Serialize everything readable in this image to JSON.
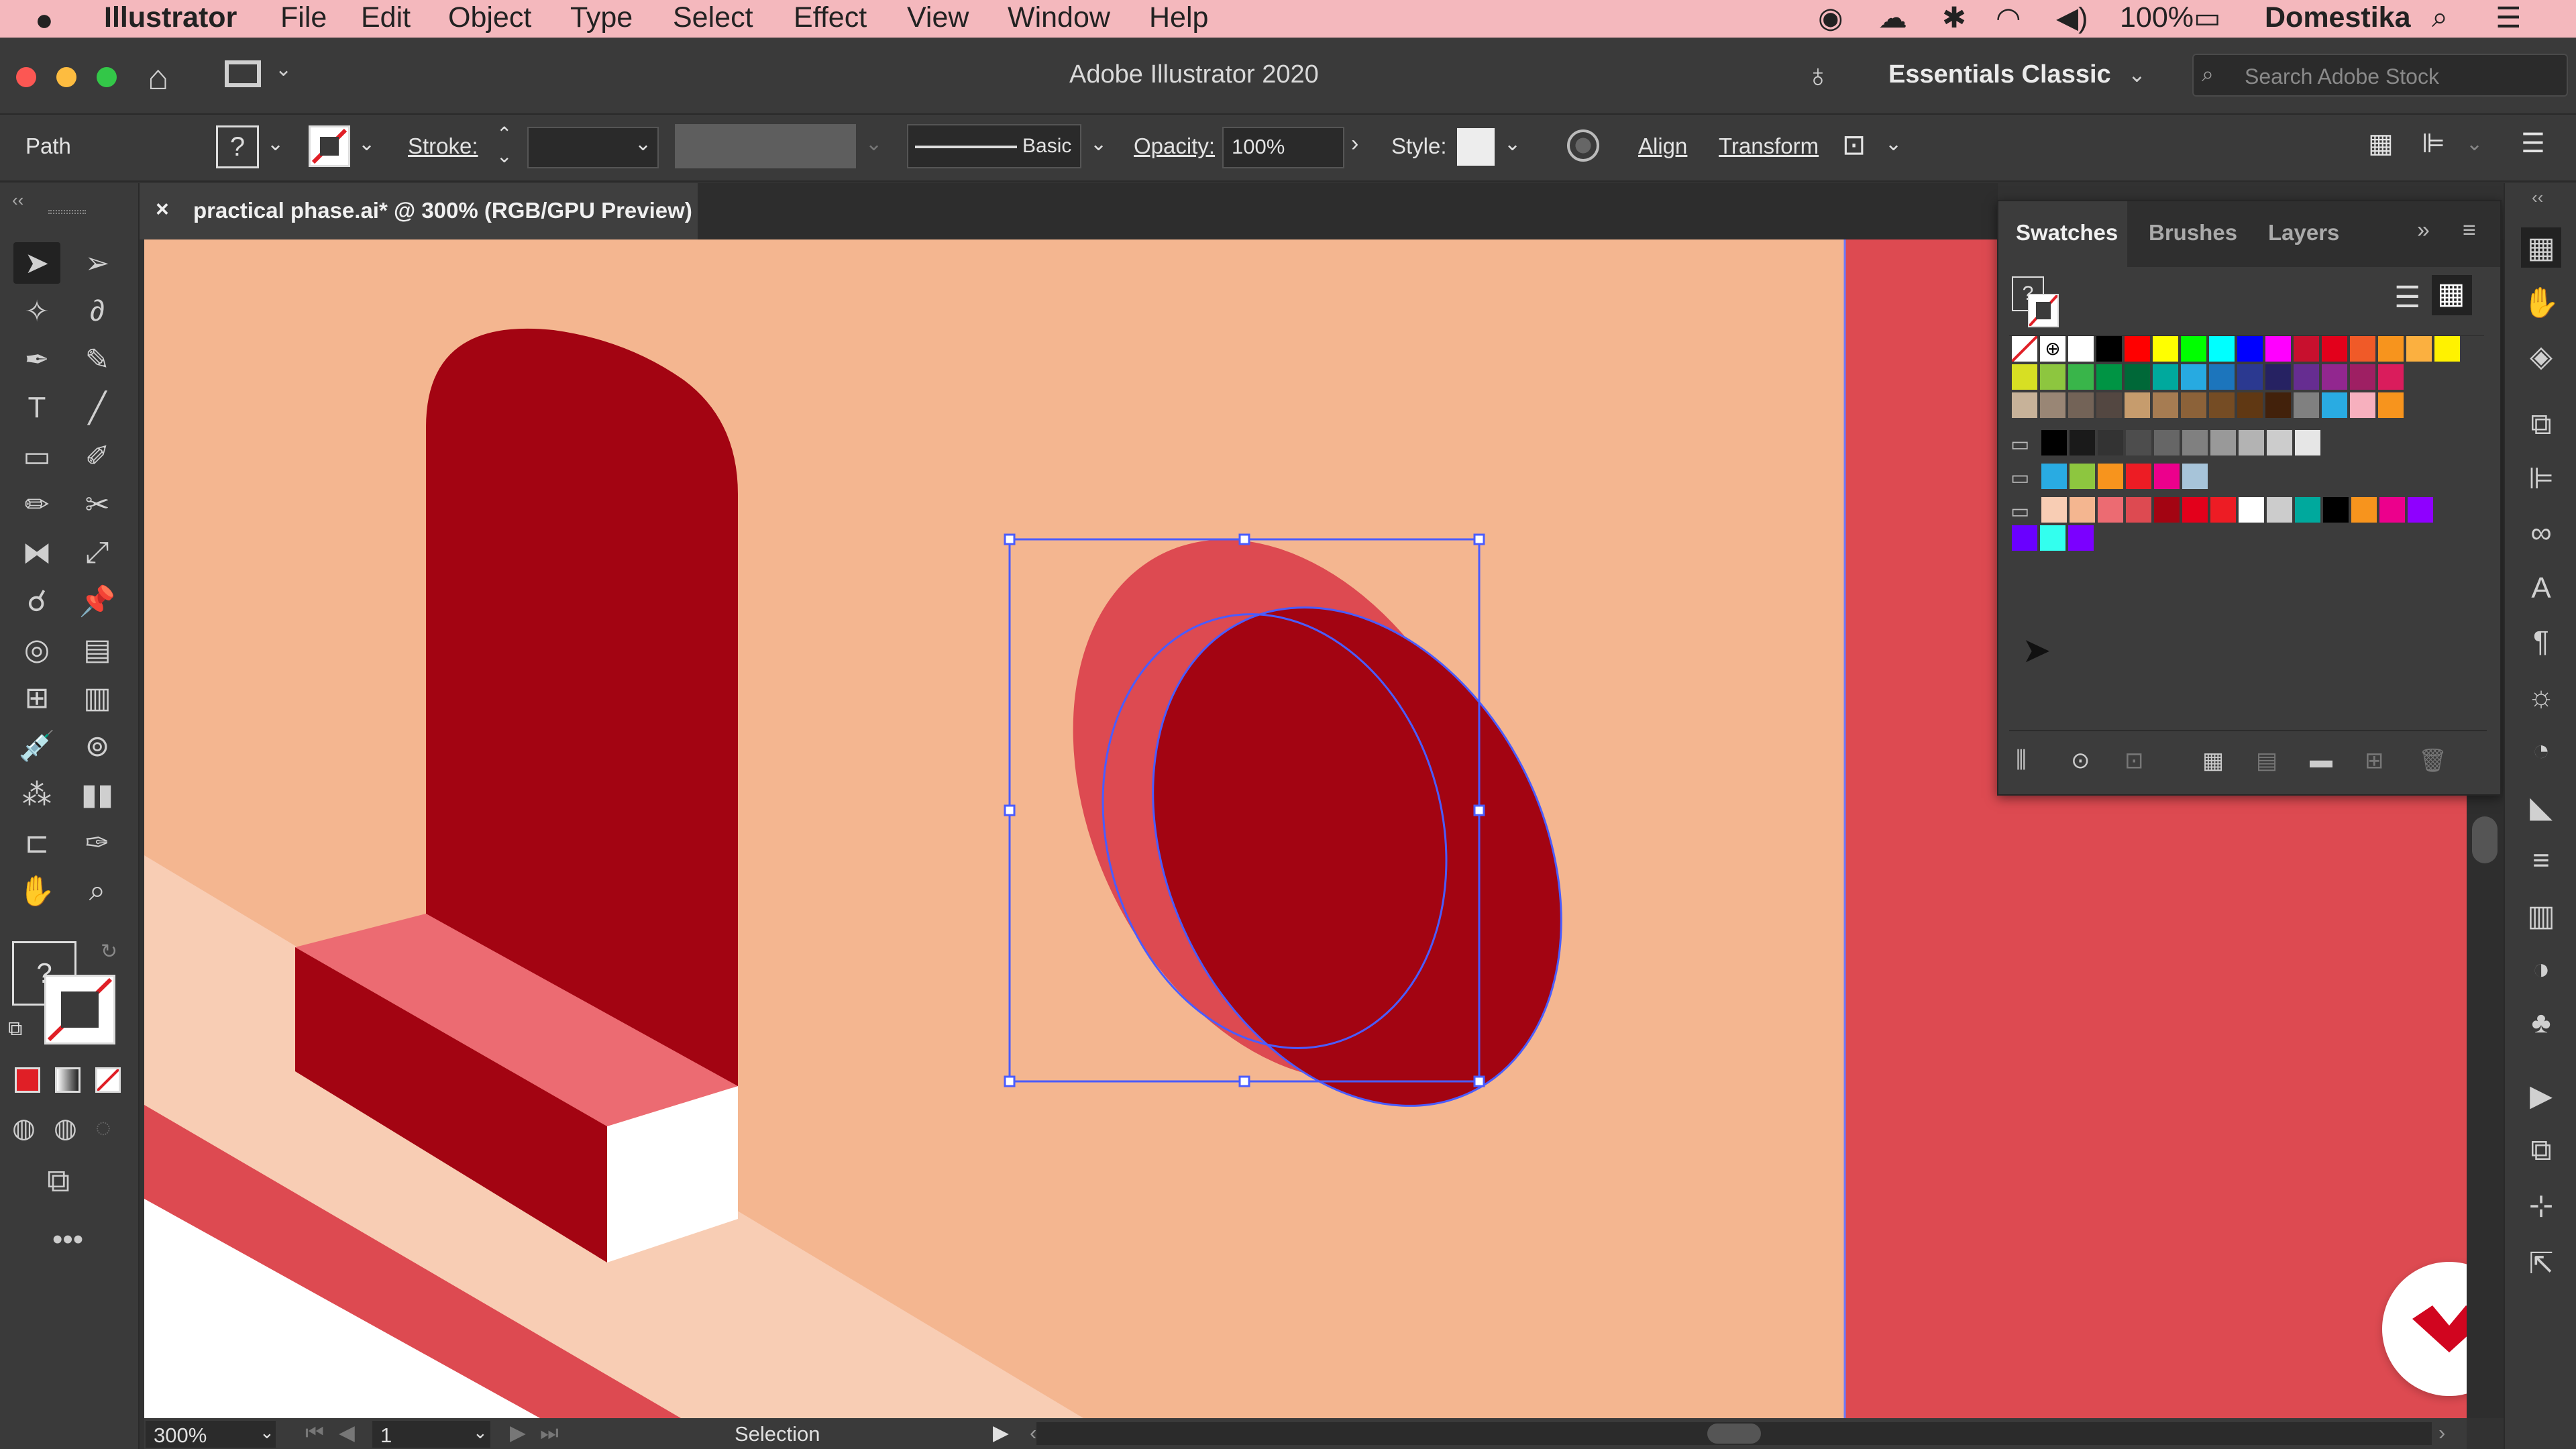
{
  "menubar": {
    "apple": "",
    "app": "Illustrator",
    "items": [
      "File",
      "Edit",
      "Object",
      "Type",
      "Select",
      "Effect",
      "View",
      "Window",
      "Help"
    ],
    "battery": "100%",
    "user": "Domestika"
  },
  "titlebar": {
    "title": "Adobe Illustrator 2020",
    "workspace": "Essentials Classic",
    "search_placeholder": "Search Adobe Stock"
  },
  "control": {
    "path_label": "Path",
    "stroke_label": "Stroke:",
    "brush_label": "Basic",
    "opacity_label": "Opacity:",
    "opacity_value": "100%",
    "style_label": "Style:",
    "align_label": "Align",
    "transform_label": "Transform"
  },
  "document": {
    "tab_title": "practical phase.ai* @ 300% (RGB/GPU Preview)",
    "close": "×"
  },
  "status": {
    "zoom": "300%",
    "artboard": "1",
    "mode": "Selection"
  },
  "panel": {
    "tabs": [
      "Swatches",
      "Brushes",
      "Layers"
    ],
    "active_tab": "Swatches"
  },
  "colors": {
    "canvas_bg": "#f4b690",
    "dark_red": "#a30412",
    "mid_red": "#dd4a51",
    "pink": "#ec6b72",
    "light_peach": "#f8cdb4",
    "selection": "#4a5cff",
    "domestika_red": "#d1051f"
  },
  "swatch_rows": [
    [
      "#ffffff",
      "#000000",
      "#ff0000",
      "#ffff00",
      "#00ff00",
      "#00ffff",
      "#0000ff",
      "#ff00ff",
      "#c8102e",
      "#e3001b",
      "#f05a28",
      "#f7941d",
      "#fbb040",
      "#fff200"
    ],
    [
      "#d7df23",
      "#8dc63f",
      "#39b54a",
      "#009444",
      "#006838",
      "#00a99d",
      "#27aae1",
      "#1c75bc",
      "#2b3990",
      "#262262",
      "#662d91",
      "#92278f",
      "#9e1f63",
      "#da1c5c"
    ],
    [
      "#c7b299",
      "#998675",
      "#736357",
      "#534741",
      "#c69c6d",
      "#a67c52",
      "#8c6239",
      "#754c24",
      "#603813",
      "#42210b",
      "#808080",
      "#29abe2",
      "#f7b0be",
      "#f7941d"
    ],
    [
      "#000000",
      "#1a1a1a",
      "#333333",
      "#4d4d4d",
      "#666666",
      "#808080",
      "#999999",
      "#b3b3b3",
      "#cccccc",
      "#e6e6e6"
    ],
    [
      "#29abe2",
      "#8dc63f",
      "#f7941d",
      "#ed1c24",
      "#ec008c",
      "#a7c4d9"
    ],
    [
      "#f8cdb4",
      "#f4b690",
      "#ec6b72",
      "#dd4a51",
      "#a30412",
      "#e3001b",
      "#ed1c24",
      "#ffffff",
      "#cccccc",
      "#00a99d",
      "#000000",
      "#f7941d",
      "#ec008c",
      "#8f00ff"
    ],
    [
      "#6a00ff",
      "#33ffee",
      "#7b00ff"
    ]
  ]
}
